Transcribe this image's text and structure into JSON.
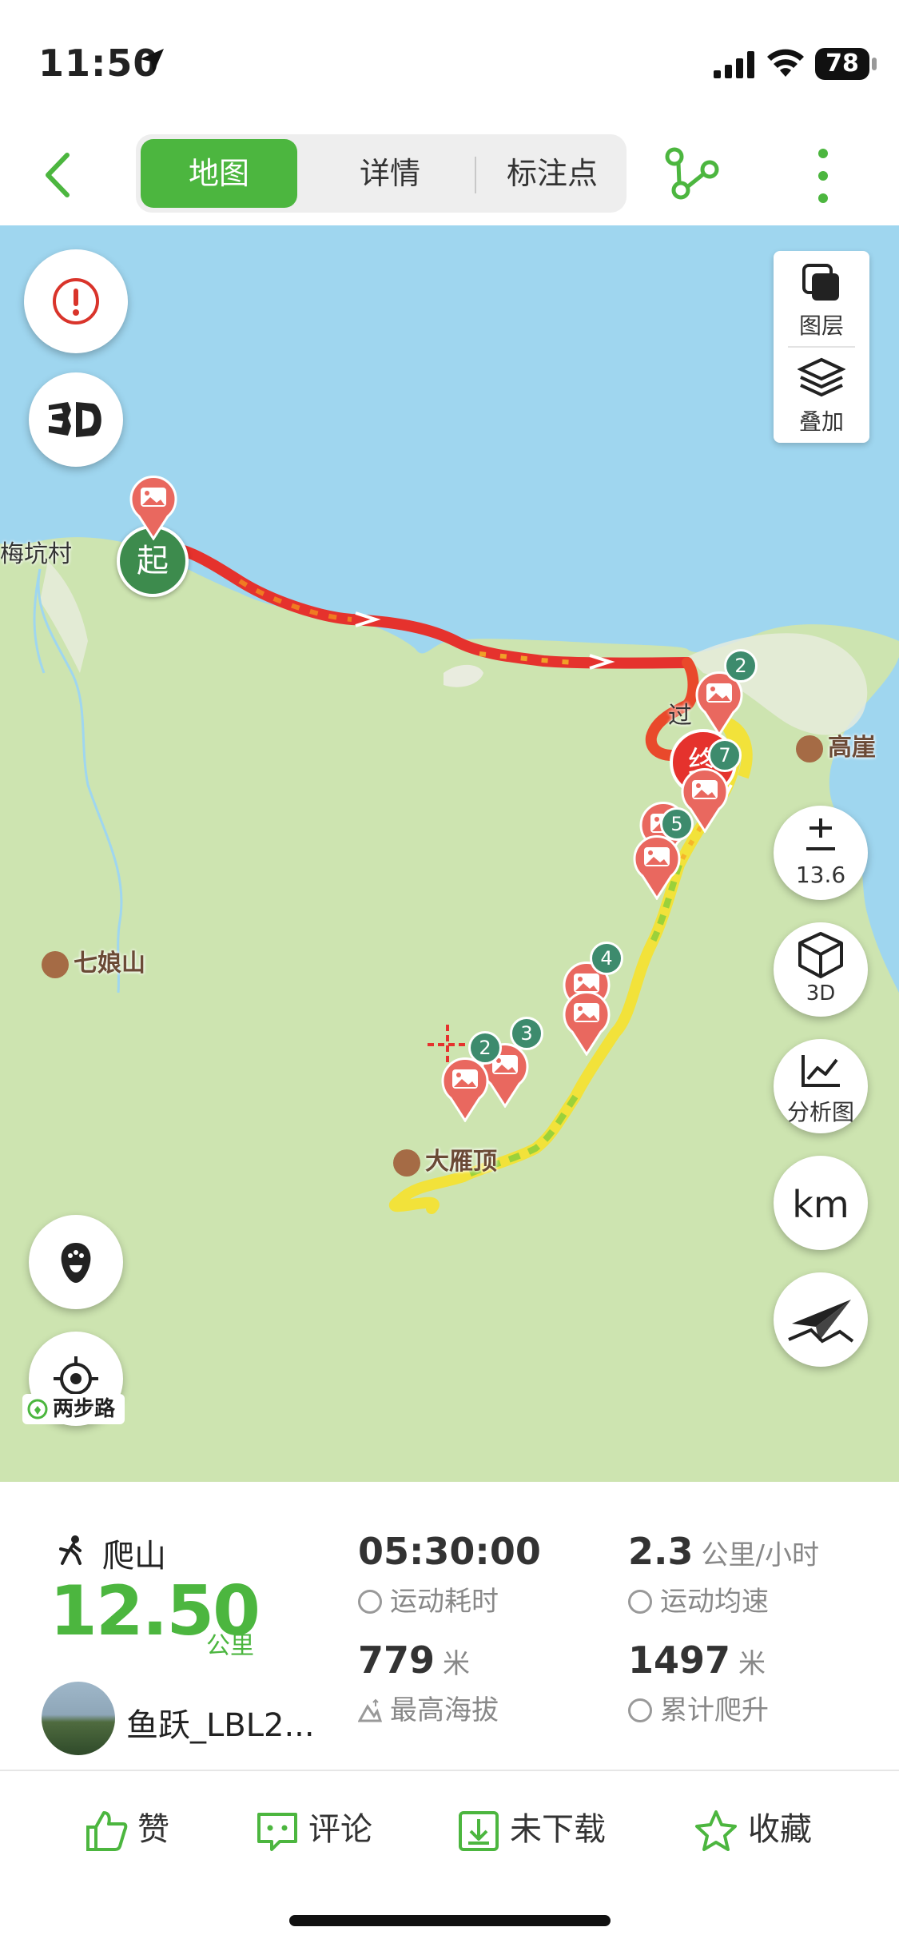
{
  "status_bar": {
    "time": "11:50",
    "battery": "78"
  },
  "tabs": [
    {
      "label": "地图",
      "active": true
    },
    {
      "label": "详情",
      "active": false
    },
    {
      "label": "标注点",
      "active": false
    }
  ],
  "map": {
    "layers_label": "图层",
    "overlay_label": "叠加",
    "zoom_level": "13.6",
    "btn_3d_label": "3D",
    "analysis_label": "分析图",
    "unit_label": "km",
    "brand": "两步路",
    "start_marker": "起",
    "end_marker": "终",
    "place_labels": {
      "village": "梅坑村",
      "gaoya": "高崖",
      "qiniang": "七娘山",
      "dayan": "大雁顶",
      "guo": "过"
    },
    "waypoint_badges": [
      "2",
      "7",
      "5",
      "4",
      "3",
      "2"
    ]
  },
  "stats": {
    "sport_type": "爬山",
    "distance": "12.50",
    "distance_unit": "公里",
    "user_name": "鱼跃_LBL2...",
    "duration": "05:30:00",
    "duration_label": "运动耗时",
    "avg_speed": "2.3",
    "avg_speed_unit": "公里/小时",
    "avg_speed_label": "运动均速",
    "max_altitude": "779",
    "max_altitude_unit": "米",
    "max_altitude_label": "最高海拔",
    "total_climb": "1497",
    "total_climb_unit": "米",
    "total_climb_label": "累计爬升"
  },
  "actions": {
    "like": "赞",
    "comment": "评论",
    "download": "未下载",
    "favorite": "收藏"
  },
  "colors": {
    "accent": "#4cb63f",
    "sea": "#9fd6ef",
    "land": "#cde4b0",
    "track_fast": "#e5322d",
    "track_slow": "#f2e23a",
    "pin": "#e9685f",
    "badge": "#3d8b6d"
  }
}
